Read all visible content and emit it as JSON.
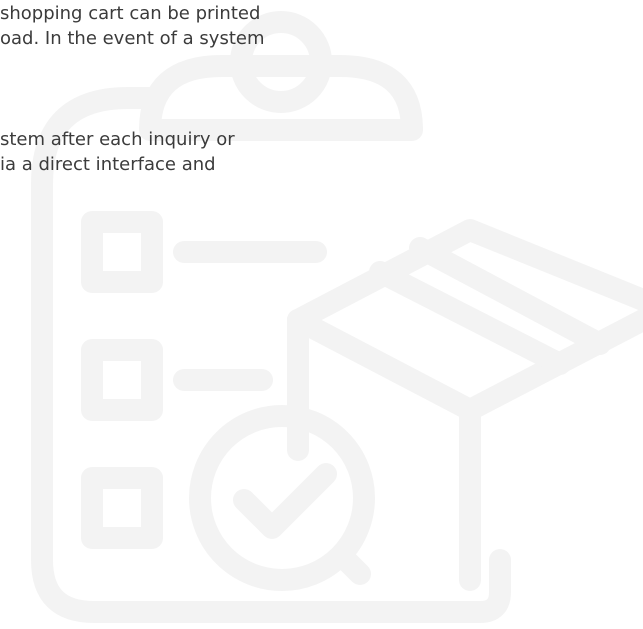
{
  "background": {
    "icon": "clipboard-checklist-box-checkmark-icon",
    "stroke_color": "#f3f3f3"
  },
  "content": {
    "paragraph_1": {
      "line_1": "shopping cart can be printed",
      "line_2": "oad. In the event of a system"
    },
    "paragraph_2": {
      "line_1": "stem after each inquiry or",
      "line_2": "ia a direct interface and"
    }
  }
}
